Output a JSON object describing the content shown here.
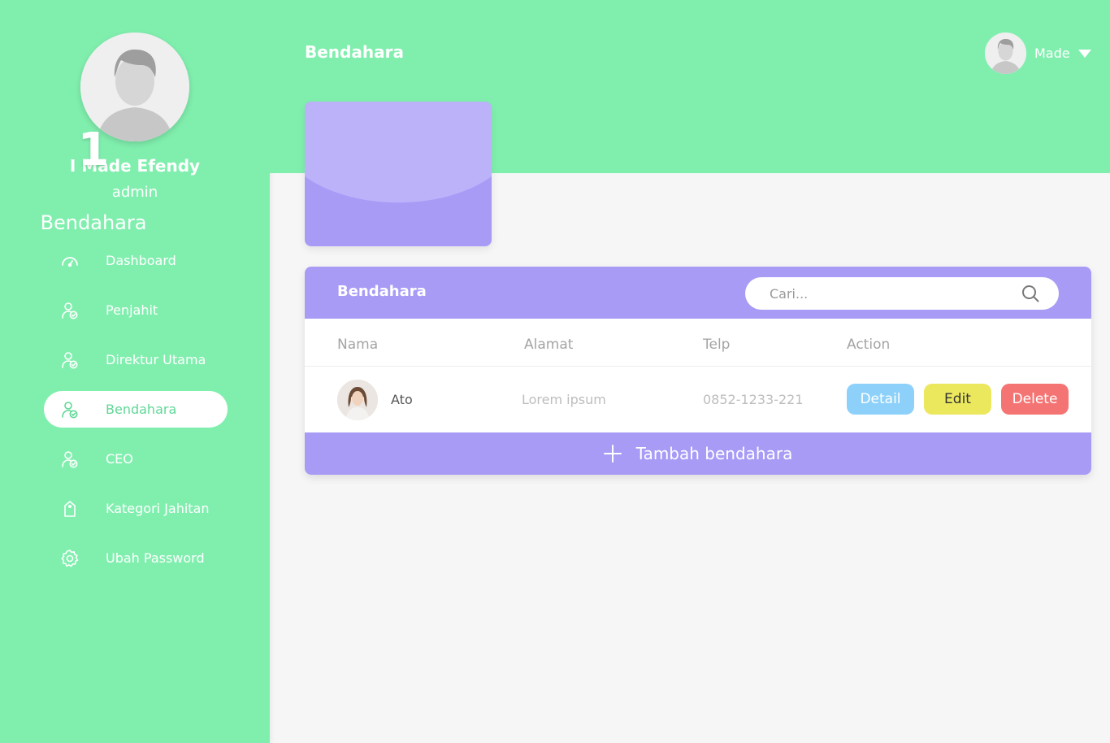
{
  "sidebar": {
    "user_name": "I Made Efendy",
    "user_role": "admin",
    "items": [
      {
        "label": "Dashboard",
        "icon": "gauge-icon",
        "active": false
      },
      {
        "label": "Penjahit",
        "icon": "user-check-icon",
        "active": false
      },
      {
        "label": "Direktur Utama",
        "icon": "user-check-icon",
        "active": false
      },
      {
        "label": "Bendahara",
        "icon": "user-check-icon",
        "active": true
      },
      {
        "label": "CEO",
        "icon": "user-check-icon",
        "active": false
      },
      {
        "label": "Kategori Jahitan",
        "icon": "tag-icon",
        "active": false
      },
      {
        "label": "Ubah Password",
        "icon": "gear-icon",
        "active": false
      }
    ]
  },
  "header": {
    "title": "Bendahara",
    "user_name": "Made"
  },
  "stat_card": {
    "count": "1",
    "label": "Bendahara"
  },
  "panel": {
    "title": "Bendahara",
    "search_placeholder": "Cari...",
    "columns": [
      "Nama",
      "Alamat",
      "Telp",
      "Action"
    ],
    "rows": [
      {
        "name": "Ato",
        "alamat": "Lorem ipsum",
        "telp": "0852-1233-221"
      }
    ],
    "actions": {
      "detail": "Detail",
      "edit": "Edit",
      "delete": "Delete"
    },
    "add_label": "Tambah bendahara"
  },
  "colors": {
    "green": "#80efae",
    "purple": "#a79bf6",
    "detail": "#8dd1fb",
    "edit": "#ece85e",
    "delete": "#f47474"
  }
}
